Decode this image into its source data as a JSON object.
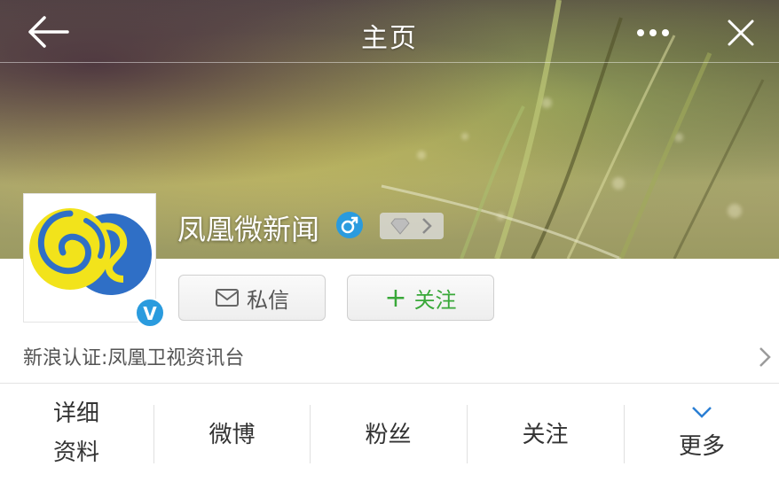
{
  "nav": {
    "title": "主页"
  },
  "profile": {
    "name": "凤凰微新闻",
    "verified_text": "V",
    "verification": "新浪认证:凤凰卫视资讯台"
  },
  "actions": {
    "message_label": "私信",
    "follow_label": "关注",
    "follow_prefix": "+"
  },
  "tabs": {
    "details_line1": "详细",
    "details_line2": "资料",
    "weibo": "微博",
    "fans": "粉丝",
    "following": "关注",
    "more": "更多"
  },
  "colors": {
    "follow_green": "#39a839",
    "verified_blue": "#2a9bde",
    "logo_yellow": "#f2e31b",
    "logo_blue": "#2f6fc6"
  },
  "icons": [
    "back-arrow-icon",
    "more-dots-icon",
    "close-icon",
    "male-gender-icon",
    "gem-icon",
    "chevron-right-icon",
    "mail-icon",
    "plus-icon",
    "chevron-down-icon",
    "verified-v-icon"
  ]
}
